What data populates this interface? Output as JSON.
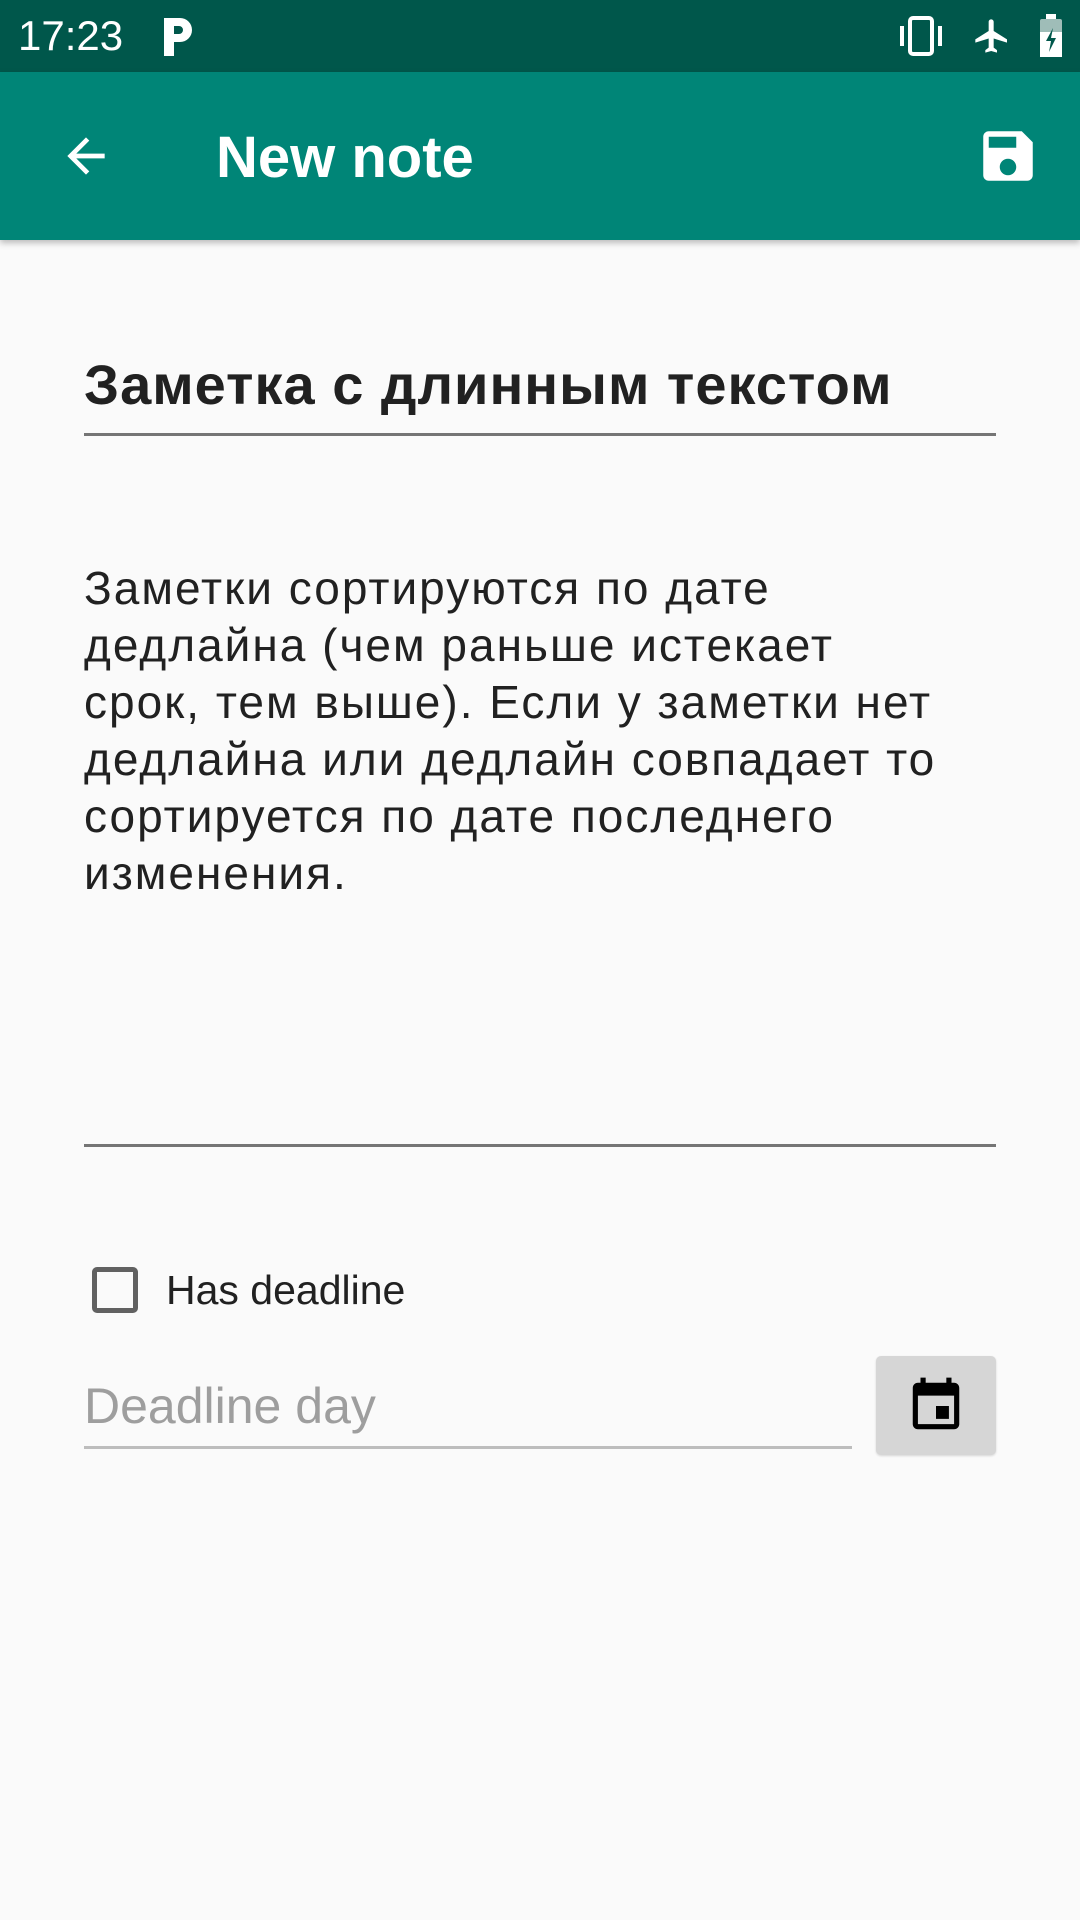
{
  "status_bar": {
    "time": "17:23",
    "icons": [
      "parking-icon",
      "vibrate-icon",
      "airplane-icon",
      "battery-charging-icon"
    ]
  },
  "app_bar": {
    "title": "New note",
    "back_icon": "arrow-back-icon",
    "save_icon": "save-icon"
  },
  "note": {
    "title_value": "Заметка с длинным текстом",
    "body_value": "Заметки сортируются по дате\nдедлайна (чем раньше истекает\nсрок, тем выше). Если у заметки нет\nдедлайна или дедлайн совпадает то\nсортируется по дате последнего\nизменения."
  },
  "deadline": {
    "checkbox_label": "Has deadline",
    "checked": false,
    "day_placeholder": "Deadline day",
    "calendar_icon": "calendar-icon"
  },
  "colors": {
    "status_bar": "#00574b",
    "app_bar": "#008577",
    "background": "#fafafa"
  }
}
